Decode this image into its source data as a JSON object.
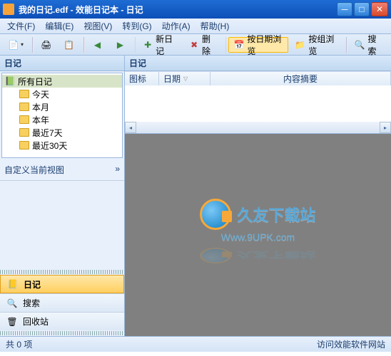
{
  "window": {
    "title": "我的日记.edf - 效能日记本 - 日记"
  },
  "menu": {
    "file": "文件(F)",
    "edit": "编辑(E)",
    "view": "视图(V)",
    "goto": "转到(G)",
    "action": "动作(A)",
    "help": "帮助(H)"
  },
  "toolbar": {
    "new_diary": "新日记",
    "delete": "删除",
    "browse_by_date": "按日期浏览",
    "browse_by_group": "按组浏览",
    "search": "搜索"
  },
  "sidebar": {
    "header": "日记",
    "tree": {
      "root": "所有日记",
      "items": [
        "今天",
        "本月",
        "本年",
        "最近7天",
        "最近30天"
      ]
    },
    "custom_view": "自定义当前视图",
    "nav": {
      "diary": "日记",
      "search": "搜索",
      "recycle": "回收站"
    }
  },
  "content": {
    "header": "日记",
    "columns": {
      "icon": "图标",
      "date": "日期",
      "summary": "内容摘要"
    }
  },
  "watermark": {
    "text": "久友下载站",
    "url": "Www.9UPK.com"
  },
  "status": {
    "count": "共 0 项"
  },
  "footer": {
    "link": "访问效能软件网站"
  }
}
